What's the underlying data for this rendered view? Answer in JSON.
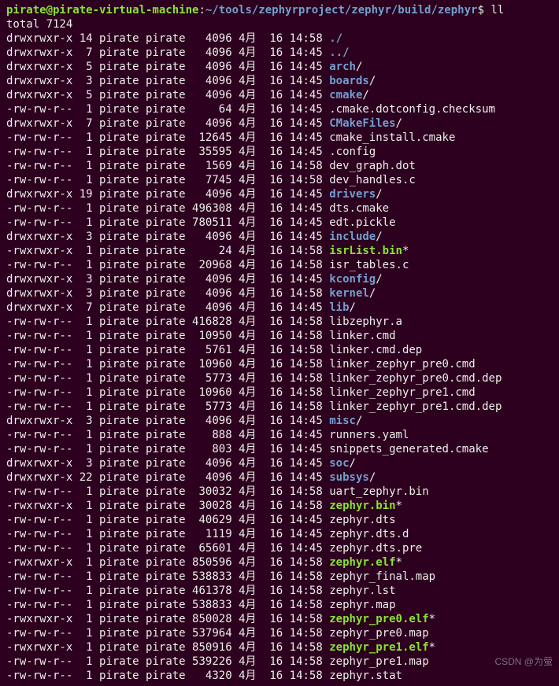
{
  "prompt": {
    "user_host": "pirate@pirate-virtual-machine",
    "colon": ":",
    "path": "~/tools/zephyrproject/zephyr/build/zephyr",
    "dollar": "$ ",
    "command": "ll"
  },
  "total_line": "total 7124",
  "rows": [
    {
      "perm": "drwxrwxr-x",
      "links": "14",
      "owner": "pirate",
      "group": "pirate",
      "size": "4096",
      "month": "4月",
      "day": "16",
      "time": "14:58",
      "name": "./",
      "type": "dir",
      "suffix": ""
    },
    {
      "perm": "drwxrwxr-x",
      "links": "7",
      "owner": "pirate",
      "group": "pirate",
      "size": "4096",
      "month": "4月",
      "day": "16",
      "time": "14:45",
      "name": "../",
      "type": "dir",
      "suffix": ""
    },
    {
      "perm": "drwxrwxr-x",
      "links": "5",
      "owner": "pirate",
      "group": "pirate",
      "size": "4096",
      "month": "4月",
      "day": "16",
      "time": "14:45",
      "name": "arch",
      "type": "dir",
      "suffix": "/"
    },
    {
      "perm": "drwxrwxr-x",
      "links": "3",
      "owner": "pirate",
      "group": "pirate",
      "size": "4096",
      "month": "4月",
      "day": "16",
      "time": "14:45",
      "name": "boards",
      "type": "dir",
      "suffix": "/"
    },
    {
      "perm": "drwxrwxr-x",
      "links": "5",
      "owner": "pirate",
      "group": "pirate",
      "size": "4096",
      "month": "4月",
      "day": "16",
      "time": "14:45",
      "name": "cmake",
      "type": "dir",
      "suffix": "/"
    },
    {
      "perm": "-rw-rw-r--",
      "links": "1",
      "owner": "pirate",
      "group": "pirate",
      "size": "64",
      "month": "4月",
      "day": "16",
      "time": "14:45",
      "name": ".cmake.dotconfig.checksum",
      "type": "file",
      "suffix": ""
    },
    {
      "perm": "drwxrwxr-x",
      "links": "7",
      "owner": "pirate",
      "group": "pirate",
      "size": "4096",
      "month": "4月",
      "day": "16",
      "time": "14:45",
      "name": "CMakeFiles",
      "type": "dir",
      "suffix": "/"
    },
    {
      "perm": "-rw-rw-r--",
      "links": "1",
      "owner": "pirate",
      "group": "pirate",
      "size": "12645",
      "month": "4月",
      "day": "16",
      "time": "14:45",
      "name": "cmake_install.cmake",
      "type": "file",
      "suffix": ""
    },
    {
      "perm": "-rw-rw-r--",
      "links": "1",
      "owner": "pirate",
      "group": "pirate",
      "size": "35595",
      "month": "4月",
      "day": "16",
      "time": "14:45",
      "name": ".config",
      "type": "file",
      "suffix": ""
    },
    {
      "perm": "-rw-rw-r--",
      "links": "1",
      "owner": "pirate",
      "group": "pirate",
      "size": "1569",
      "month": "4月",
      "day": "16",
      "time": "14:58",
      "name": "dev_graph.dot",
      "type": "file",
      "suffix": ""
    },
    {
      "perm": "-rw-rw-r--",
      "links": "1",
      "owner": "pirate",
      "group": "pirate",
      "size": "7745",
      "month": "4月",
      "day": "16",
      "time": "14:58",
      "name": "dev_handles.c",
      "type": "file",
      "suffix": ""
    },
    {
      "perm": "drwxrwxr-x",
      "links": "19",
      "owner": "pirate",
      "group": "pirate",
      "size": "4096",
      "month": "4月",
      "day": "16",
      "time": "14:45",
      "name": "drivers",
      "type": "dir",
      "suffix": "/"
    },
    {
      "perm": "-rw-rw-r--",
      "links": "1",
      "owner": "pirate",
      "group": "pirate",
      "size": "496308",
      "month": "4月",
      "day": "16",
      "time": "14:45",
      "name": "dts.cmake",
      "type": "file",
      "suffix": ""
    },
    {
      "perm": "-rw-rw-r--",
      "links": "1",
      "owner": "pirate",
      "group": "pirate",
      "size": "780511",
      "month": "4月",
      "day": "16",
      "time": "14:45",
      "name": "edt.pickle",
      "type": "file",
      "suffix": ""
    },
    {
      "perm": "drwxrwxr-x",
      "links": "3",
      "owner": "pirate",
      "group": "pirate",
      "size": "4096",
      "month": "4月",
      "day": "16",
      "time": "14:45",
      "name": "include",
      "type": "dir",
      "suffix": "/"
    },
    {
      "perm": "-rwxrwxr-x",
      "links": "1",
      "owner": "pirate",
      "group": "pirate",
      "size": "24",
      "month": "4月",
      "day": "16",
      "time": "14:58",
      "name": "isrList.bin",
      "type": "exe",
      "suffix": "*"
    },
    {
      "perm": "-rw-rw-r--",
      "links": "1",
      "owner": "pirate",
      "group": "pirate",
      "size": "20968",
      "month": "4月",
      "day": "16",
      "time": "14:58",
      "name": "isr_tables.c",
      "type": "file",
      "suffix": ""
    },
    {
      "perm": "drwxrwxr-x",
      "links": "3",
      "owner": "pirate",
      "group": "pirate",
      "size": "4096",
      "month": "4月",
      "day": "16",
      "time": "14:45",
      "name": "kconfig",
      "type": "dir",
      "suffix": "/"
    },
    {
      "perm": "drwxrwxr-x",
      "links": "3",
      "owner": "pirate",
      "group": "pirate",
      "size": "4096",
      "month": "4月",
      "day": "16",
      "time": "14:58",
      "name": "kernel",
      "type": "dir",
      "suffix": "/"
    },
    {
      "perm": "drwxrwxr-x",
      "links": "7",
      "owner": "pirate",
      "group": "pirate",
      "size": "4096",
      "month": "4月",
      "day": "16",
      "time": "14:45",
      "name": "lib",
      "type": "dir",
      "suffix": "/"
    },
    {
      "perm": "-rw-rw-r--",
      "links": "1",
      "owner": "pirate",
      "group": "pirate",
      "size": "416828",
      "month": "4月",
      "day": "16",
      "time": "14:58",
      "name": "libzephyr.a",
      "type": "file",
      "suffix": ""
    },
    {
      "perm": "-rw-rw-r--",
      "links": "1",
      "owner": "pirate",
      "group": "pirate",
      "size": "10950",
      "month": "4月",
      "day": "16",
      "time": "14:58",
      "name": "linker.cmd",
      "type": "file",
      "suffix": ""
    },
    {
      "perm": "-rw-rw-r--",
      "links": "1",
      "owner": "pirate",
      "group": "pirate",
      "size": "5761",
      "month": "4月",
      "day": "16",
      "time": "14:58",
      "name": "linker.cmd.dep",
      "type": "file",
      "suffix": ""
    },
    {
      "perm": "-rw-rw-r--",
      "links": "1",
      "owner": "pirate",
      "group": "pirate",
      "size": "10960",
      "month": "4月",
      "day": "16",
      "time": "14:58",
      "name": "linker_zephyr_pre0.cmd",
      "type": "file",
      "suffix": ""
    },
    {
      "perm": "-rw-rw-r--",
      "links": "1",
      "owner": "pirate",
      "group": "pirate",
      "size": "5773",
      "month": "4月",
      "day": "16",
      "time": "14:58",
      "name": "linker_zephyr_pre0.cmd.dep",
      "type": "file",
      "suffix": ""
    },
    {
      "perm": "-rw-rw-r--",
      "links": "1",
      "owner": "pirate",
      "group": "pirate",
      "size": "10960",
      "month": "4月",
      "day": "16",
      "time": "14:58",
      "name": "linker_zephyr_pre1.cmd",
      "type": "file",
      "suffix": ""
    },
    {
      "perm": "-rw-rw-r--",
      "links": "1",
      "owner": "pirate",
      "group": "pirate",
      "size": "5773",
      "month": "4月",
      "day": "16",
      "time": "14:58",
      "name": "linker_zephyr_pre1.cmd.dep",
      "type": "file",
      "suffix": ""
    },
    {
      "perm": "drwxrwxr-x",
      "links": "3",
      "owner": "pirate",
      "group": "pirate",
      "size": "4096",
      "month": "4月",
      "day": "16",
      "time": "14:45",
      "name": "misc",
      "type": "dir",
      "suffix": "/"
    },
    {
      "perm": "-rw-rw-r--",
      "links": "1",
      "owner": "pirate",
      "group": "pirate",
      "size": "888",
      "month": "4月",
      "day": "16",
      "time": "14:45",
      "name": "runners.yaml",
      "type": "file",
      "suffix": ""
    },
    {
      "perm": "-rw-rw-r--",
      "links": "1",
      "owner": "pirate",
      "group": "pirate",
      "size": "803",
      "month": "4月",
      "day": "16",
      "time": "14:45",
      "name": "snippets_generated.cmake",
      "type": "file",
      "suffix": ""
    },
    {
      "perm": "drwxrwxr-x",
      "links": "3",
      "owner": "pirate",
      "group": "pirate",
      "size": "4096",
      "month": "4月",
      "day": "16",
      "time": "14:45",
      "name": "soc",
      "type": "dir",
      "suffix": "/"
    },
    {
      "perm": "drwxrwxr-x",
      "links": "22",
      "owner": "pirate",
      "group": "pirate",
      "size": "4096",
      "month": "4月",
      "day": "16",
      "time": "14:45",
      "name": "subsys",
      "type": "dir",
      "suffix": "/"
    },
    {
      "perm": "-rw-rw-r--",
      "links": "1",
      "owner": "pirate",
      "group": "pirate",
      "size": "30032",
      "month": "4月",
      "day": "16",
      "time": "14:58",
      "name": "uart_zephyr.bin",
      "type": "file",
      "suffix": ""
    },
    {
      "perm": "-rwxrwxr-x",
      "links": "1",
      "owner": "pirate",
      "group": "pirate",
      "size": "30028",
      "month": "4月",
      "day": "16",
      "time": "14:58",
      "name": "zephyr.bin",
      "type": "exe",
      "suffix": "*"
    },
    {
      "perm": "-rw-rw-r--",
      "links": "1",
      "owner": "pirate",
      "group": "pirate",
      "size": "40629",
      "month": "4月",
      "day": "16",
      "time": "14:45",
      "name": "zephyr.dts",
      "type": "file",
      "suffix": ""
    },
    {
      "perm": "-rw-rw-r--",
      "links": "1",
      "owner": "pirate",
      "group": "pirate",
      "size": "1119",
      "month": "4月",
      "day": "16",
      "time": "14:45",
      "name": "zephyr.dts.d",
      "type": "file",
      "suffix": ""
    },
    {
      "perm": "-rw-rw-r--",
      "links": "1",
      "owner": "pirate",
      "group": "pirate",
      "size": "65601",
      "month": "4月",
      "day": "16",
      "time": "14:45",
      "name": "zephyr.dts.pre",
      "type": "file",
      "suffix": ""
    },
    {
      "perm": "-rwxrwxr-x",
      "links": "1",
      "owner": "pirate",
      "group": "pirate",
      "size": "850596",
      "month": "4月",
      "day": "16",
      "time": "14:58",
      "name": "zephyr.elf",
      "type": "exe",
      "suffix": "*"
    },
    {
      "perm": "-rw-rw-r--",
      "links": "1",
      "owner": "pirate",
      "group": "pirate",
      "size": "538833",
      "month": "4月",
      "day": "16",
      "time": "14:58",
      "name": "zephyr_final.map",
      "type": "file",
      "suffix": ""
    },
    {
      "perm": "-rw-rw-r--",
      "links": "1",
      "owner": "pirate",
      "group": "pirate",
      "size": "461378",
      "month": "4月",
      "day": "16",
      "time": "14:58",
      "name": "zephyr.lst",
      "type": "file",
      "suffix": ""
    },
    {
      "perm": "-rw-rw-r--",
      "links": "1",
      "owner": "pirate",
      "group": "pirate",
      "size": "538833",
      "month": "4月",
      "day": "16",
      "time": "14:58",
      "name": "zephyr.map",
      "type": "file",
      "suffix": ""
    },
    {
      "perm": "-rwxrwxr-x",
      "links": "1",
      "owner": "pirate",
      "group": "pirate",
      "size": "850028",
      "month": "4月",
      "day": "16",
      "time": "14:58",
      "name": "zephyr_pre0.elf",
      "type": "exe",
      "suffix": "*"
    },
    {
      "perm": "-rw-rw-r--",
      "links": "1",
      "owner": "pirate",
      "group": "pirate",
      "size": "537964",
      "month": "4月",
      "day": "16",
      "time": "14:58",
      "name": "zephyr_pre0.map",
      "type": "file",
      "suffix": ""
    },
    {
      "perm": "-rwxrwxr-x",
      "links": "1",
      "owner": "pirate",
      "group": "pirate",
      "size": "850916",
      "month": "4月",
      "day": "16",
      "time": "14:58",
      "name": "zephyr_pre1.elf",
      "type": "exe",
      "suffix": "*"
    },
    {
      "perm": "-rw-rw-r--",
      "links": "1",
      "owner": "pirate",
      "group": "pirate",
      "size": "539226",
      "month": "4月",
      "day": "16",
      "time": "14:58",
      "name": "zephyr_pre1.map",
      "type": "file",
      "suffix": ""
    },
    {
      "perm": "-rw-rw-r--",
      "links": "1",
      "owner": "pirate",
      "group": "pirate",
      "size": "4320",
      "month": "4月",
      "day": "16",
      "time": "14:58",
      "name": "zephyr.stat",
      "type": "file",
      "suffix": ""
    }
  ],
  "watermark": "CSDN @为萤"
}
